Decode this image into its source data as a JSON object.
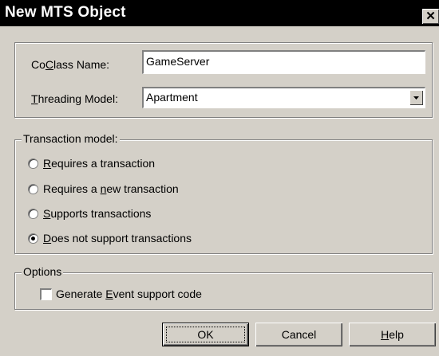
{
  "window": {
    "title": "New MTS Object",
    "close_glyph": "✕"
  },
  "coclass": {
    "label_pre": "Co",
    "label_key": "C",
    "label_post": "lass Name:",
    "value": "GameServer"
  },
  "threading": {
    "label_pre": "",
    "label_key": "T",
    "label_post": "hreading Model:",
    "value": "Apartment"
  },
  "transaction": {
    "legend": "Transaction model:",
    "options": [
      {
        "pre": "",
        "key": "R",
        "post": "equires a transaction",
        "checked": false
      },
      {
        "pre": "Requires a ",
        "key": "n",
        "post": "ew transaction",
        "checked": false
      },
      {
        "pre": "",
        "key": "S",
        "post": "upports transactions",
        "checked": false
      },
      {
        "pre": "",
        "key": "D",
        "post": "oes not support transactions",
        "checked": true
      }
    ]
  },
  "options": {
    "legend": "Options",
    "generate_event": {
      "pre": "Generate ",
      "key": "E",
      "post": "vent support code",
      "checked": false
    }
  },
  "buttons": {
    "ok": "OK",
    "cancel": "Cancel",
    "help_key": "H",
    "help_post": "elp"
  },
  "icons": {
    "close": "close-icon",
    "dropdown": "chevron-down-icon"
  }
}
